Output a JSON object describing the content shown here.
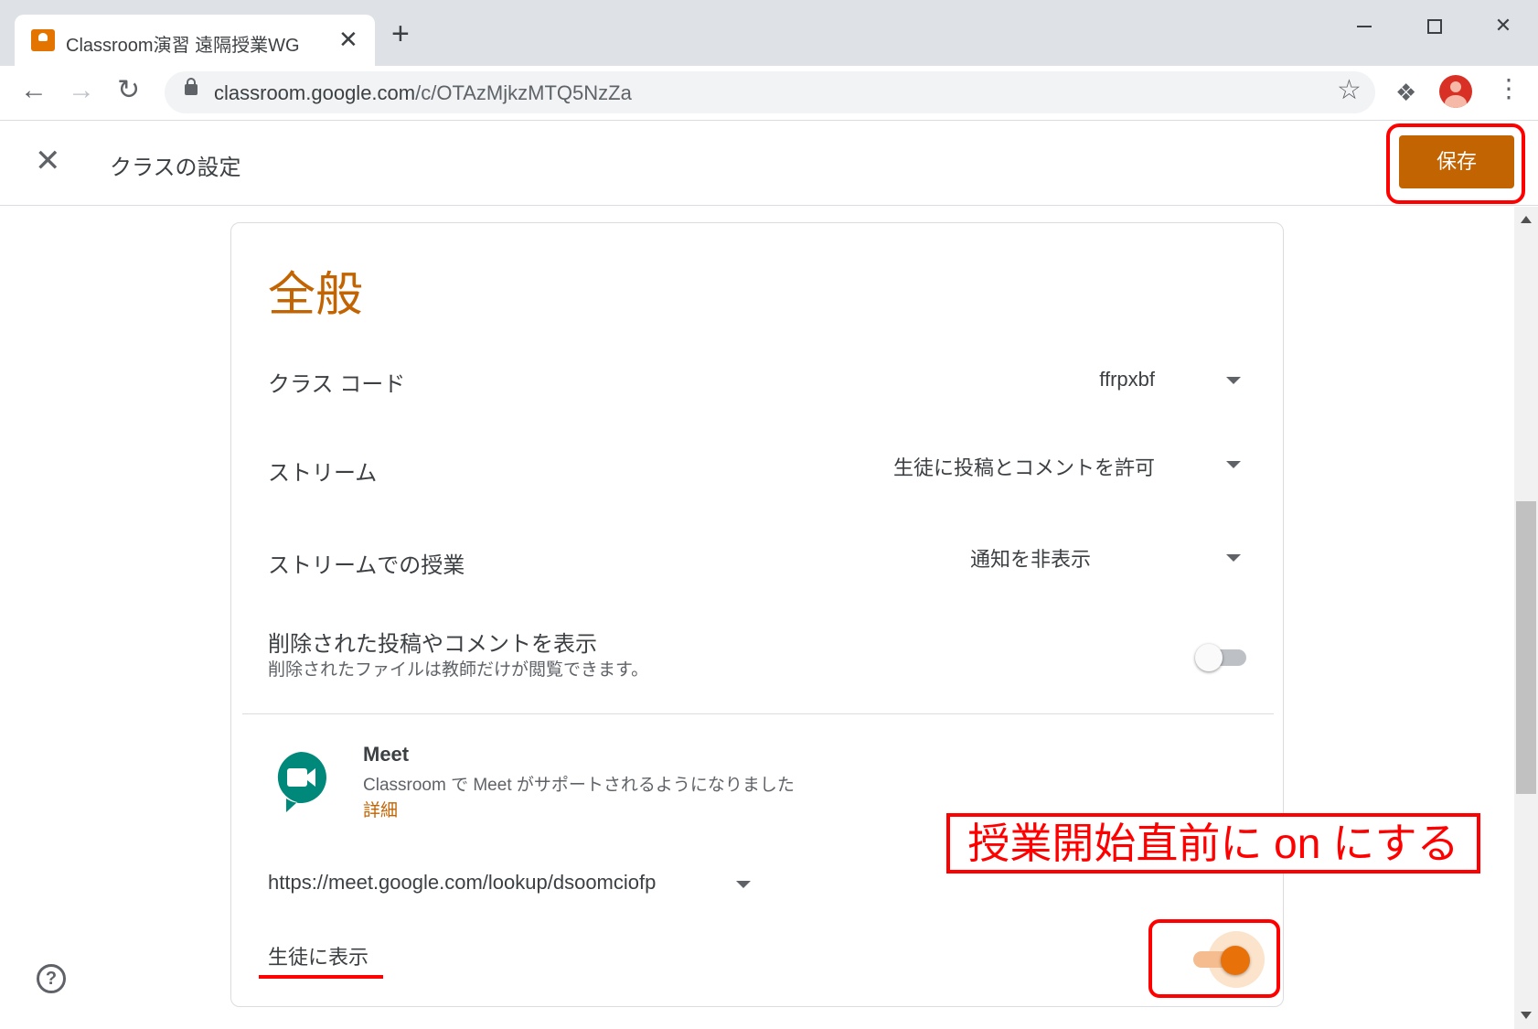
{
  "browser": {
    "tab": {
      "title": "Classroom演習 遠隔授業WG",
      "close_glyph": "✕"
    },
    "new_tab_glyph": "+",
    "url_host": "classroom.google.com",
    "url_path": "/c/OTAzMjkzMTQ5NzZa"
  },
  "header": {
    "title": "クラスの設定",
    "save_label": "保存"
  },
  "general": {
    "title": "全般",
    "class_code": {
      "label": "クラス コード",
      "value": "ffrpxbf"
    },
    "stream": {
      "label": "ストリーム",
      "value": "生徒に投稿とコメントを許可"
    },
    "classwork_on_stream": {
      "label": "ストリームでの授業",
      "value": "通知を非表示"
    },
    "show_deleted": {
      "label": "削除された投稿やコメントを表示",
      "sub": "削除されたファイルは教師だけが閲覧できます。",
      "enabled": false
    }
  },
  "meet": {
    "title": "Meet",
    "description": "Classroom で Meet がサポートされるようになりました",
    "details_link": "詳細",
    "url": "https://meet.google.com/lookup/dsoomciofp",
    "visible_label": "生徒に表示",
    "visible_enabled": true
  },
  "annotation": "授業開始直前に on にする",
  "colors": {
    "accent": "#c26401",
    "meet_green": "#00897b",
    "annotation_red": "#ff0000",
    "toggle_on": "#e8710a"
  }
}
